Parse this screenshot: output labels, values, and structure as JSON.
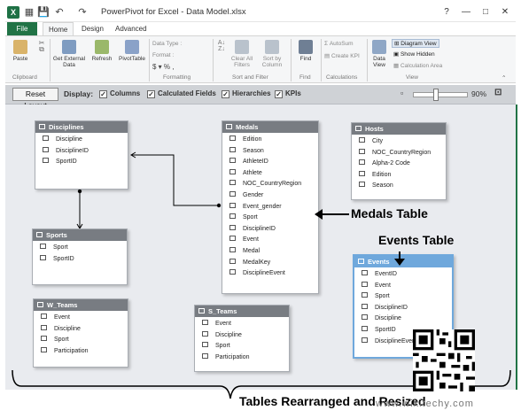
{
  "window": {
    "title": "PowerPivot for Excel - Data Model.xlsx",
    "controls": {
      "help": "?",
      "minimize": "—",
      "maximize": "□",
      "close": "✕"
    }
  },
  "quick_access": {
    "save": "💾",
    "undo": "↶",
    "redo": "↷"
  },
  "tabs": {
    "file": "File",
    "home": "Home",
    "design": "Design",
    "advanced": "Advanced"
  },
  "ribbon": {
    "clipboard": {
      "paste": "Paste",
      "label": "Clipboard"
    },
    "get_external_data": [
      "Get External",
      "Data"
    ],
    "refresh": "Refresh",
    "pivottable": "PivotTable",
    "formatting": {
      "data_type": "Data Type :",
      "format": "Format :",
      "symbols": "$ ▾ %  ,",
      "label": "Formatting"
    },
    "sort_filter": {
      "clear_filters": [
        "Clear All",
        "Filters"
      ],
      "sort_by_column": [
        "Sort by",
        "Column"
      ],
      "label": "Sort and Filter"
    },
    "find": {
      "find": "Find",
      "label": "Find"
    },
    "calculations": {
      "autosum": "AutoSum",
      "create_kpi": "Create KPI",
      "label": "Calculations"
    },
    "view": {
      "data_view": [
        "Data",
        "View"
      ],
      "diagram_view": "Diagram View",
      "show_hidden": "Show Hidden",
      "calculation_area": "Calculation Area",
      "label": "View"
    }
  },
  "display_bar": {
    "reset_layout": "Reset Layout",
    "display_label": "Display:",
    "checkboxes": [
      {
        "label": "Columns",
        "checked": true
      },
      {
        "label": "Calculated Fields",
        "checked": true
      },
      {
        "label": "Hierarchies",
        "checked": true
      },
      {
        "label": "KPIs",
        "checked": true
      }
    ],
    "zoom": "90%",
    "zoom_level_percent": 90
  },
  "tables": {
    "disciplines": {
      "name": "Disciplines",
      "fields": [
        "Discipline",
        "DisciplineID",
        "SportID"
      ]
    },
    "medals": {
      "name": "Medals",
      "fields": [
        "Edition",
        "Season",
        "AthleteID",
        "Athlete",
        "NOC_CountryRegion",
        "Gender",
        "Event_gender",
        "Sport",
        "DisciplineID",
        "Event",
        "Medal",
        "MedalKey",
        "DisciplineEvent"
      ]
    },
    "hosts": {
      "name": "Hosts",
      "fields": [
        "City",
        "NOC_CountryRegion",
        "Alpha-2 Code",
        "Edition",
        "Season"
      ]
    },
    "sports": {
      "name": "Sports",
      "fields": [
        "Sport",
        "SportID"
      ]
    },
    "w_teams": {
      "name": "W_Teams",
      "fields": [
        "Event",
        "Discipline",
        "Sport",
        "Participation"
      ]
    },
    "s_teams": {
      "name": "S_Teams",
      "fields": [
        "Event",
        "Discipline",
        "Sport",
        "Participation"
      ]
    },
    "events": {
      "name": "Events",
      "fields": [
        "EventID",
        "Event",
        "Sport",
        "DisciplineID",
        "Discipline",
        "SportID",
        "DisciplineEvent"
      ]
    }
  },
  "annotations": {
    "medals_table": "Medals Table",
    "events_table": "Events Table",
    "tables_rearranged": "Tables Rearranged and Resized"
  },
  "watermark": "www.wikitechy.com"
}
